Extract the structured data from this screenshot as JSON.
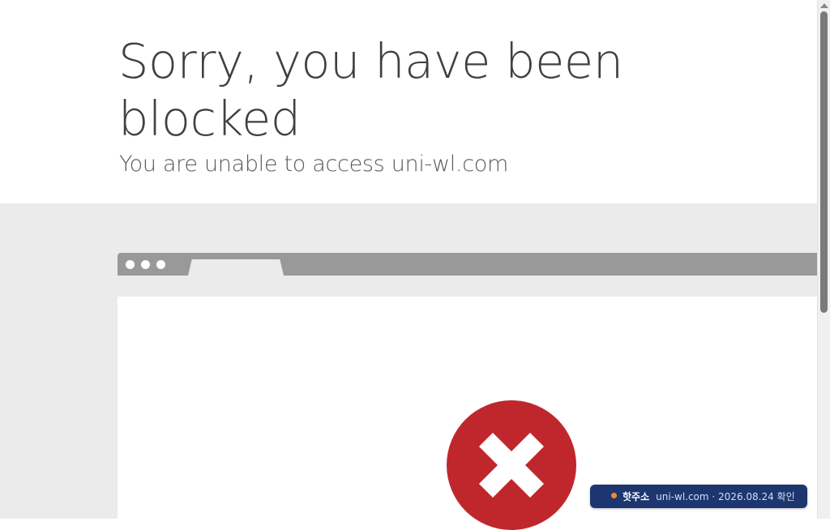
{
  "page": {
    "title": "Sorry, you have been blocked",
    "subtitle": "You are unable to access uni-wl.com"
  },
  "icons": {
    "blocked": "x-circle-icon"
  },
  "colors": {
    "error_red": "#c0272d",
    "toast_background": "#1d3670",
    "toast_dot": "#f08a2c"
  },
  "toast": {
    "label": "핫주소",
    "text": "uni-wl.com · 2026.08.24 확인"
  }
}
